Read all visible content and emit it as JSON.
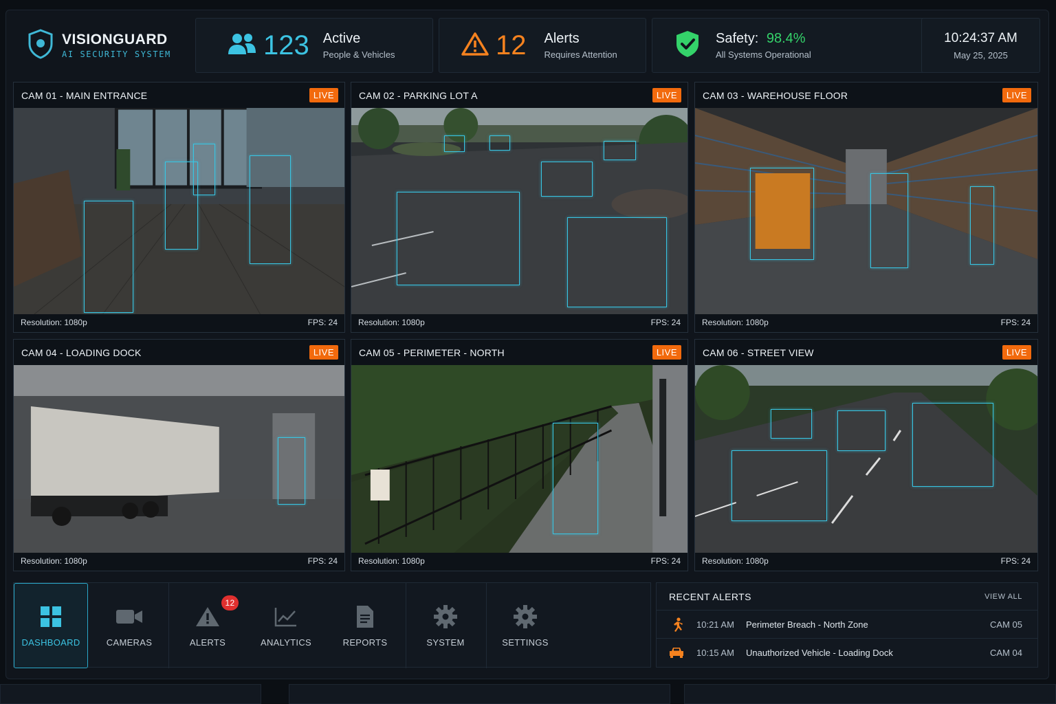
{
  "app": {
    "name": "VISIONGUARD",
    "subtitle": "AI SECURITY SYSTEM"
  },
  "stats": {
    "active": {
      "count": "123",
      "title": "Active",
      "subtitle": "People & Vehicles",
      "color": "#3cc3e2"
    },
    "alerts": {
      "count": "12",
      "title": "Alerts",
      "subtitle": "Requires Attention",
      "color": "#f5821f"
    },
    "safety": {
      "label": "Safety:",
      "value": "98.4%",
      "subtitle": "All Systems Operational",
      "color": "#34d36a"
    },
    "clock": {
      "time": "10:24:37 AM",
      "date": "May 25, 2025"
    }
  },
  "cameras": [
    {
      "title": "CAM 01 - MAIN ENTRANCE",
      "badge": "LIVE",
      "resolution": "Resolution: 1080p",
      "fps": "FPS: 24"
    },
    {
      "title": "CAM 02 - PARKING LOT A",
      "badge": "LIVE",
      "resolution": "Resolution: 1080p",
      "fps": "FPS: 24"
    },
    {
      "title": "CAM 03 - WAREHOUSE FLOOR",
      "badge": "LIVE",
      "resolution": "Resolution: 1080p",
      "fps": "FPS: 24"
    },
    {
      "title": "CAM 04 - LOADING DOCK",
      "badge": "LIVE",
      "resolution": "Resolution: 1080p",
      "fps": "FPS: 24"
    },
    {
      "title": "CAM 05 - PERIMETER - NORTH",
      "badge": "LIVE",
      "resolution": "Resolution: 1080p",
      "fps": "FPS: 24"
    },
    {
      "title": "CAM 06 - STREET VIEW",
      "badge": "LIVE",
      "resolution": "Resolution: 1080p",
      "fps": "FPS: 24"
    }
  ],
  "nav": {
    "items": [
      {
        "label": "DASHBOARD",
        "icon": "grid-icon",
        "active": true
      },
      {
        "label": "CAMERAS",
        "icon": "camera-icon"
      },
      {
        "label": "ALERTS",
        "icon": "warning-icon",
        "badge": "12"
      },
      {
        "label": "ANALYTICS",
        "icon": "chart-icon"
      },
      {
        "label": "REPORTS",
        "icon": "document-icon"
      },
      {
        "label": "SYSTEM",
        "icon": "gear-icon"
      },
      {
        "label": "SETTINGS",
        "icon": "gear-icon"
      }
    ]
  },
  "recent_alerts": {
    "title": "RECENT ALERTS",
    "view_all": "VIEW ALL",
    "items": [
      {
        "icon": "running-person-icon",
        "time": "10:21 AM",
        "message": "Perimeter Breach - North Zone",
        "camera": "CAM 05"
      },
      {
        "icon": "car-icon",
        "time": "10:15 AM",
        "message": "Unauthorized Vehicle - Loading Dock",
        "camera": "CAM 04"
      }
    ]
  },
  "colors": {
    "accent": "#3cc3e2",
    "live": "#f26a0d",
    "alert": "#f5821f",
    "ok": "#34d36a",
    "badge": "#e0302f"
  }
}
